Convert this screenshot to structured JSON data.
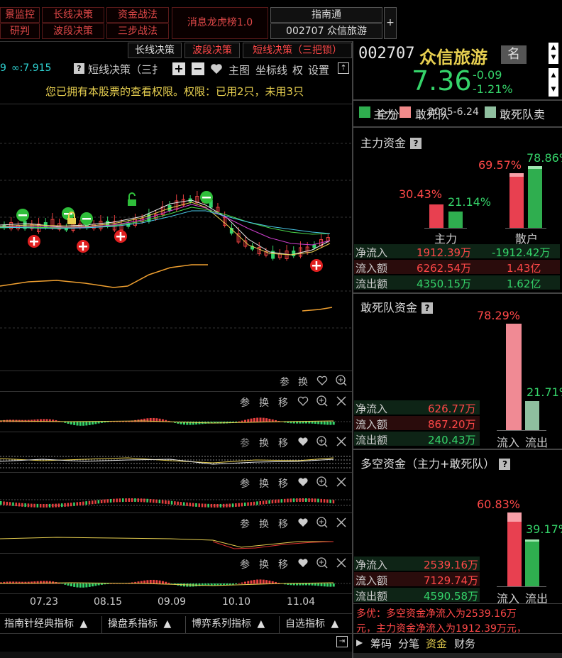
{
  "top_menu": {
    "row1": [
      "景监控",
      "长线决策",
      "资金战法"
    ],
    "row2": [
      "研判",
      "波段决策",
      "三步战法"
    ],
    "news_rank": "消息龙虎榜1.0",
    "guide": "指南通",
    "stock_tab": "002707 众信旅游",
    "plus": "+"
  },
  "chart_tabs": [
    "长线决策",
    "波段决策",
    "短线决策（三把锁）"
  ],
  "chart_toolbar": {
    "value_prefix": "9",
    "inf_value": "∞:7.915",
    "indicator_name": "短线决策（三扌",
    "main_chart": "主图",
    "coord_line": "坐标线",
    "permission": "权",
    "settings": "设置",
    "notice": "您已拥有本股票的查看权限。权限：已用2只，未用3只"
  },
  "sub_panel_buttons": [
    "参",
    "换",
    "移"
  ],
  "x_axis_labels": [
    "07.23",
    "08.15",
    "09.09",
    "10.10",
    "11.04"
  ],
  "bottom_tabs": [
    "指南针经典指标",
    "操盘系指标",
    "博弈系列指标",
    "自选指标"
  ],
  "stock": {
    "code": "002707",
    "name": "众信旅游",
    "badge": "名",
    "price": "7.36",
    "change": "-0.09",
    "change_pct": "-1.21%"
  },
  "legend": {
    "items": [
      "主力",
      "敢死队",
      "敢死队卖"
    ],
    "overlay_a": "全分",
    "overlay_date": "2025-6.24",
    "colors": {
      "main": "#2fae4f",
      "dare": "#f08a8a",
      "dare_sell": "#8fbf9f"
    }
  },
  "main_fund": {
    "title": "主力资金",
    "main_in_pct": "30.43%",
    "main_out_pct": "21.14%",
    "retail_in_pct": "69.57%",
    "retail_out_pct": "78.86%",
    "label_main": "主力",
    "label_retail": "散户",
    "rows": [
      {
        "label": "净流入",
        "v1": "1912.39万",
        "v2": "-1912.42万"
      },
      {
        "label": "流入额",
        "v1": "6262.54万",
        "v2": "1.43亿"
      },
      {
        "label": "流出额",
        "v1": "4350.15万",
        "v2": "1.62亿"
      }
    ]
  },
  "dare_fund": {
    "title": "敢死队资金",
    "in_pct": "78.29%",
    "out_pct": "21.71%",
    "label_in": "流入",
    "label_out": "流出",
    "rows": [
      {
        "label": "净流入",
        "v": "626.77万"
      },
      {
        "label": "流入额",
        "v": "867.20万"
      },
      {
        "label": "流出额",
        "v": "240.43万"
      }
    ]
  },
  "multi_fund": {
    "title": "多空资金（主力+敢死队）",
    "in_pct": "60.83%",
    "out_pct": "39.17%",
    "label_in": "流入",
    "label_out": "流出",
    "rows": [
      {
        "label": "净流入",
        "v": "2539.16万"
      },
      {
        "label": "流入额",
        "v": "7129.74万"
      },
      {
        "label": "流出额",
        "v": "4590.58万"
      }
    ],
    "summary_line1": "多优：多空资金净流入为2539.16万",
    "summary_line2": "元，主力资金净流入为1912.39万元，"
  },
  "right_bottom_tabs": [
    "筹码",
    "分笔",
    "资金",
    "财务"
  ]
}
